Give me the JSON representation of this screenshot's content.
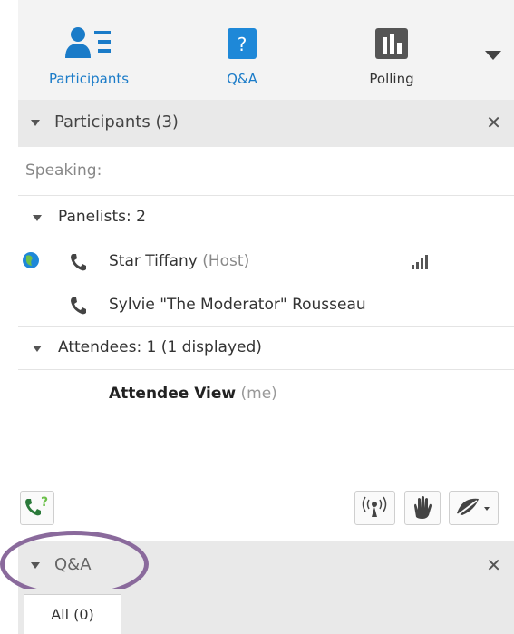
{
  "toolbar": {
    "participants_label": "Participants",
    "qa_label": "Q&A",
    "polling_label": "Polling",
    "qa_icon_glyph": "?",
    "accent": "#1a7bc8"
  },
  "participants_panel": {
    "title": "Participants (3)",
    "close_glyph": "✕",
    "speaking_label": "Speaking:",
    "panelists_label": "Panelists: 2",
    "panelists": [
      {
        "name": "Star Tiffany",
        "role": "(Host)"
      },
      {
        "name": "Sylvie \"The Moderator\" Rousseau",
        "role": ""
      }
    ],
    "attendees_label": "Attendees: 1 (1 displayed)",
    "attendee_name": "Attendee View",
    "attendee_suffix": "(me)"
  },
  "bottom_bar": {
    "icons": [
      "call-help-icon",
      "broadcast-icon",
      "raise-hand-icon",
      "emoticon-icon"
    ]
  },
  "qa_panel": {
    "title": "Q&A",
    "close_glyph": "✕",
    "tab_all": "All (0)",
    "highlight_color": "#8a6a9c"
  }
}
